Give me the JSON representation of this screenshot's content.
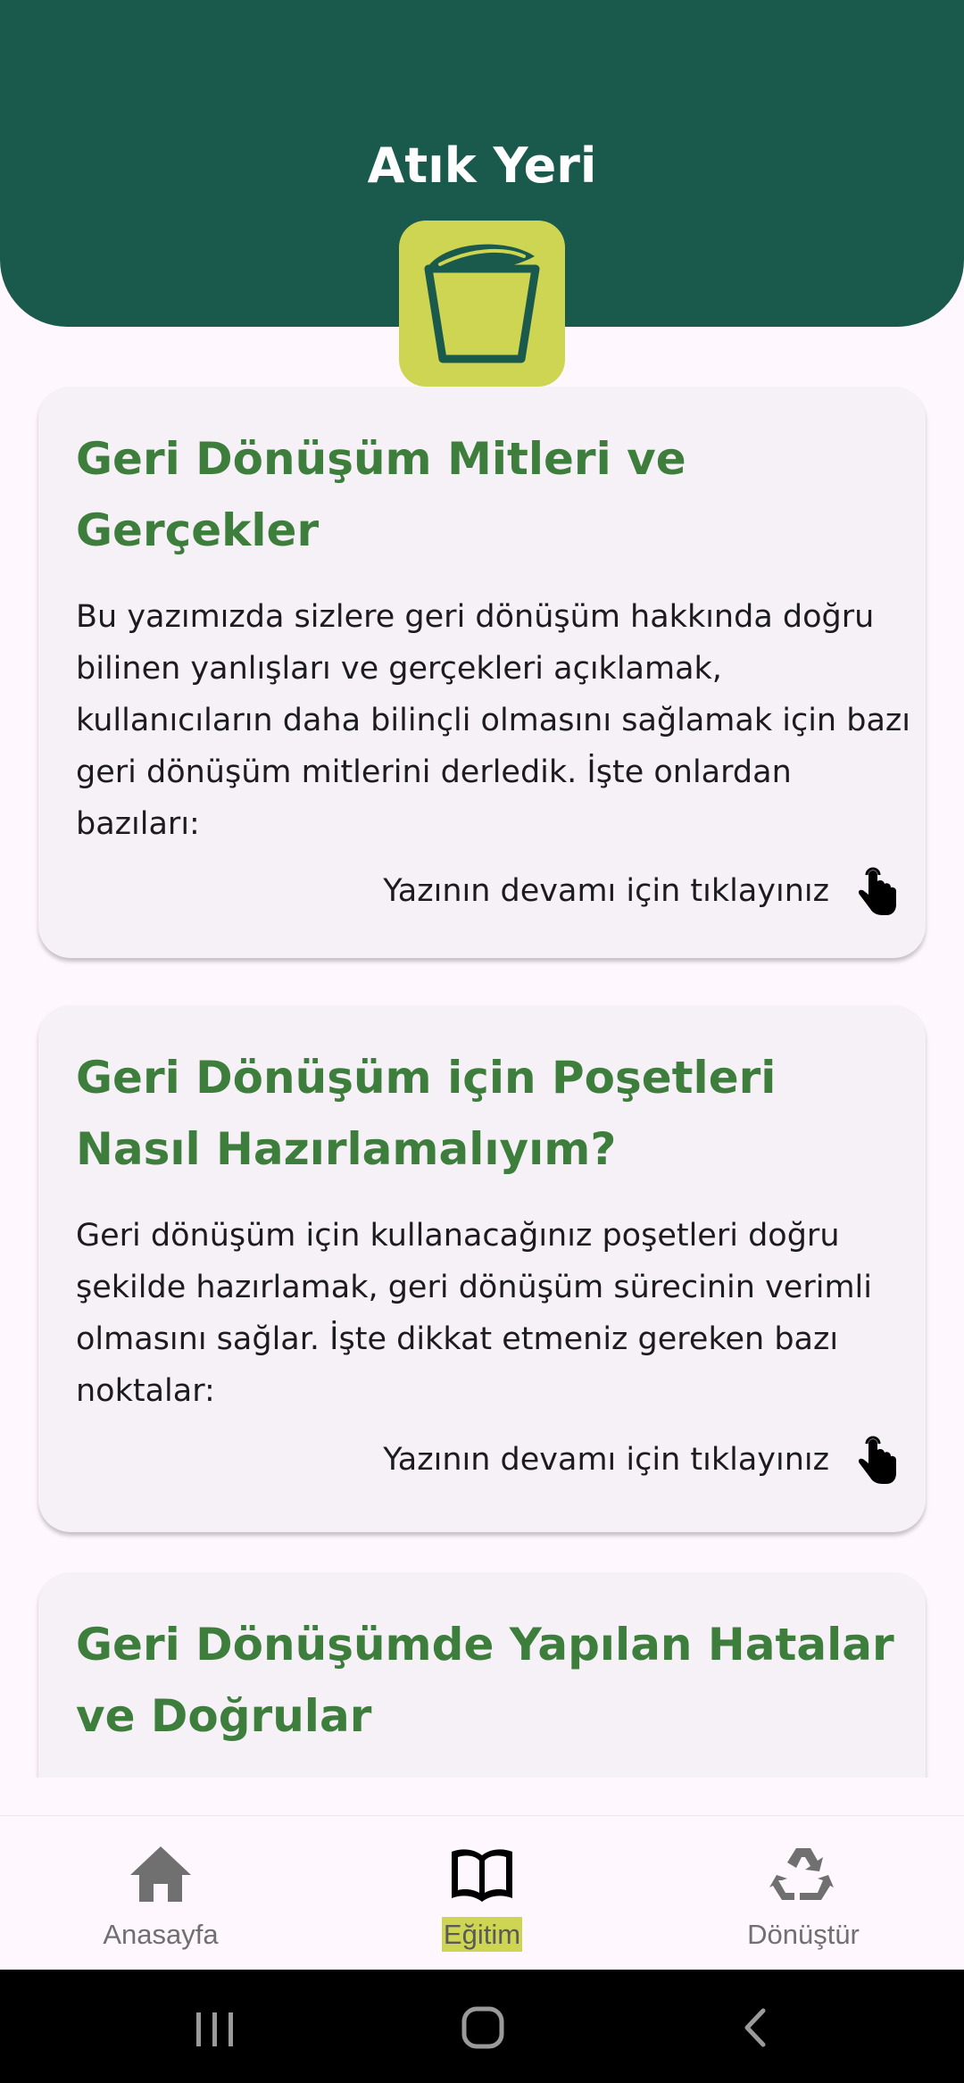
{
  "header": {
    "title": "Atık Yeri",
    "colors": {
      "background": "#1A5A4C",
      "logo_background": "#CED553"
    },
    "logo_icon": "leaf-bucket-icon"
  },
  "articles": [
    {
      "title": "Geri Dönüşüm Mitleri ve Gerçekler",
      "body": "Bu yazımızda sizlere geri dönüşüm hakkında doğru bilinen yanlışları ve gerçekleri açıklamak, kullanıcıların daha bilinçli olmasını sağlamak için bazı geri dönüşüm mitlerini derledik. İşte onlardan bazıları:",
      "read_more": "Yazının devamı için tıklayınız",
      "read_more_icon": "tap-hand-icon"
    },
    {
      "title": "Geri Dönüşüm için Poşetleri Nasıl Hazırlamalıyım?",
      "body": "Geri dönüşüm için kullanacağınız poşetleri doğru şekilde hazırlamak, geri dönüşüm sürecinin verimli olmasını sağlar. İşte dikkat etmeniz gereken bazı noktalar:",
      "read_more": "Yazının devamı için tıklayınız",
      "read_more_icon": "tap-hand-icon"
    },
    {
      "title": "Geri Dönüşümde Yapılan Hatalar ve Doğrular"
    }
  ],
  "bottom_nav": {
    "items": [
      {
        "label": "Anasayfa",
        "icon": "home-icon",
        "active": false
      },
      {
        "label": "Eğitim",
        "icon": "book-icon",
        "active": true
      },
      {
        "label": "Dönüştür",
        "icon": "recycle-icon",
        "active": false
      }
    ],
    "colors": {
      "active_highlight": "#CED553",
      "inactive": "#707070"
    }
  },
  "system_nav": {
    "buttons": [
      "recent-apps-icon",
      "home-button-icon",
      "back-icon"
    ]
  },
  "colors": {
    "card_title": "#3E7E3C",
    "card_background": "#F6F1F7",
    "page_background": "#FEF7FD"
  }
}
